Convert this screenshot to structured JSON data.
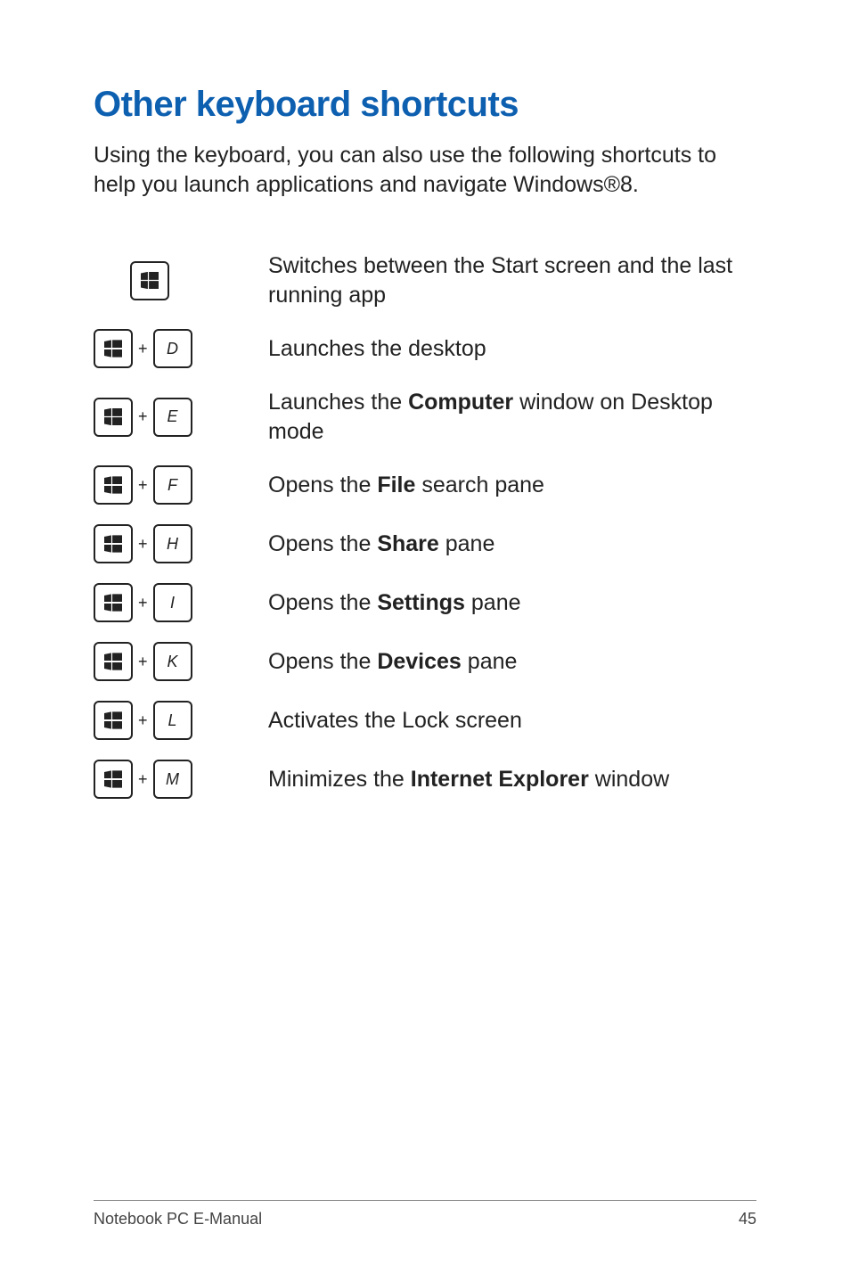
{
  "heading": "Other keyboard shortcuts",
  "intro": "Using the keyboard, you can also use the following shortcuts to help you launch applications and navigate Windows®8.",
  "rows": [
    {
      "combo": null,
      "desc_pre": "Switches between the Start screen and the last running app",
      "desc_bold": "",
      "desc_post": ""
    },
    {
      "combo": "D",
      "desc_pre": "Launches the desktop",
      "desc_bold": "",
      "desc_post": ""
    },
    {
      "combo": "E",
      "desc_pre": "Launches the ",
      "desc_bold": "Computer",
      "desc_post": " window on Desktop mode"
    },
    {
      "combo": "F",
      "desc_pre": "Opens the ",
      "desc_bold": "File",
      "desc_post": " search pane"
    },
    {
      "combo": "H",
      "desc_pre": "Opens the ",
      "desc_bold": "Share",
      "desc_post": " pane"
    },
    {
      "combo": "I",
      "desc_pre": "Opens the ",
      "desc_bold": "Settings",
      "desc_post": " pane"
    },
    {
      "combo": "K",
      "desc_pre": "Opens the ",
      "desc_bold": "Devices",
      "desc_post": " pane"
    },
    {
      "combo": "L",
      "desc_pre": "Activates the Lock screen",
      "desc_bold": "",
      "desc_post": ""
    },
    {
      "combo": "M",
      "desc_pre": "Minimizes the ",
      "desc_bold": "Internet Explorer",
      "desc_post": " window"
    }
  ],
  "footer_left": "Notebook PC E-Manual",
  "footer_right": "45",
  "plus": "+"
}
